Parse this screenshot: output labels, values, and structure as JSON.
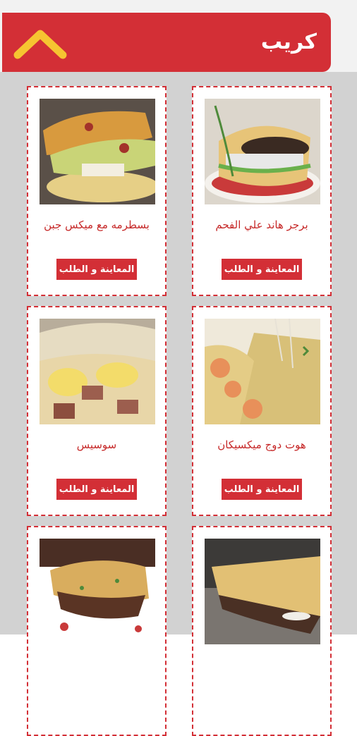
{
  "header": {
    "title": "كريب",
    "collapse_icon": "chevron-up-icon",
    "accent": "#d32f36",
    "icon_color": "#f6c431"
  },
  "items": [
    {
      "name": "برجر هاند علي الفحم",
      "button": "المعاينة و الطلب",
      "image": "burger-crepe"
    },
    {
      "name": "بسطرمه مع ميكس جبن",
      "button": "المعاينة و الطلب",
      "image": "pastrami-crepe"
    },
    {
      "name": "هوت دوج ميكسيكان",
      "button": "المعاينة و الطلب",
      "image": "hotdog-crepe"
    },
    {
      "name": "سوسيس",
      "button": "المعاينة و الطلب",
      "image": "sausage-crepe"
    },
    {
      "name": "",
      "button": "",
      "image": "crepe-5"
    },
    {
      "name": "",
      "button": "",
      "image": "crepe-6"
    }
  ]
}
